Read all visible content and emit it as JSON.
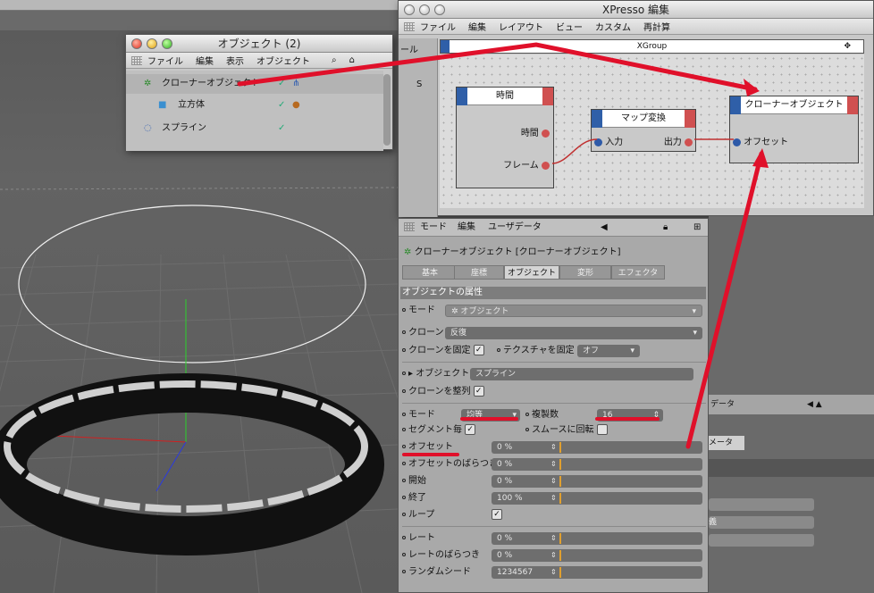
{
  "objects_window": {
    "title": "オブジェクト (2)",
    "menu": [
      "ファイル",
      "編集",
      "表示",
      "オブジェクト"
    ],
    "items": [
      {
        "label": "クローナーオブジェクト"
      },
      {
        "label": "立方体"
      },
      {
        "label": "スプライン"
      }
    ]
  },
  "xpresso_window": {
    "title": "XPresso 編集",
    "menu": [
      "ファイル",
      "編集",
      "レイアウト",
      "ビュー",
      "カスタム",
      "再計算"
    ],
    "group_title": "XGroup",
    "side_label": "ール",
    "side_s": "S",
    "nodes": {
      "time": {
        "title": "時間",
        "out1": "時間",
        "out2": "フレーム"
      },
      "range": {
        "title": "マップ変換",
        "in": "入力",
        "out": "出力"
      },
      "cloner": {
        "title": "クローナーオブジェクト",
        "in": "オフセット"
      }
    }
  },
  "attribute_manager": {
    "menu": [
      "モード",
      "編集",
      "ユーザデータ"
    ],
    "header": "クローナーオブジェクト [クローナーオブジェクト]",
    "tabs": [
      "基本",
      "座標",
      "オブジェクト",
      "変形",
      "エフェクタ"
    ],
    "section": "オブジェクトの属性",
    "mode_label": "モード",
    "mode_value": "オブジェクト",
    "clone_label": "クローン",
    "clone_value": "反復",
    "fix_clone": "クローンを固定",
    "fix_texture": "テクスチャを固定",
    "fix_texture_value": "オフ",
    "object_label": "オブジェクト",
    "object_value": "スプライン",
    "align_clone": "クローンを整列",
    "dist_mode_label": "モード",
    "dist_mode_value": "均等",
    "count_label": "複製数",
    "count_value": "16",
    "segment": "セグメント毎",
    "smooth": "スムースに回転",
    "params": [
      {
        "label": "オフセット",
        "value": "0 %"
      },
      {
        "label": "オフセットのばらつき",
        "value": "0 %"
      },
      {
        "label": "開始",
        "value": "0 %"
      },
      {
        "label": "終了",
        "value": "100 %"
      }
    ],
    "loop": "ループ",
    "params2": [
      {
        "label": "レート",
        "value": "0 %"
      },
      {
        "label": "レートのばらつき",
        "value": "0 %"
      },
      {
        "label": "ランダムシード",
        "value": "1234567"
      }
    ]
  },
  "bg_panel": {
    "t1": "データ",
    "t2": "メータ",
    "t3": "義"
  }
}
